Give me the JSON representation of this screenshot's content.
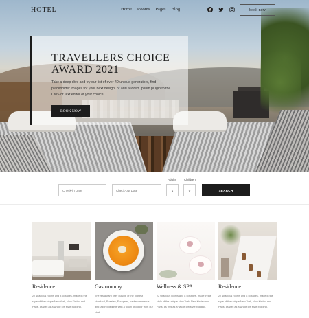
{
  "nav": {
    "logo": "HOTEL",
    "menu": [
      "Home",
      "Rooms",
      "Pages",
      "Blog"
    ],
    "social": [
      "facebook-icon",
      "twitter-icon",
      "instagram-icon"
    ],
    "book_label": "book now"
  },
  "hero": {
    "title": "TRAVELLERS CHOICE AWARD 2021",
    "text": "Take a deep dive and try our list of over 40 unique generators, find placeholder images for your next design, or add a lorem ipsum plugin to the CMS or text editor of your choice.",
    "button": "BOOK NOW"
  },
  "booking": {
    "checkin_placeholder": "Check-in Date",
    "checkout_placeholder": "Check-out Date",
    "adults_label": "Adults",
    "children_label": "Children",
    "adults_value": "1",
    "children_value": "0",
    "search_label": "SEARCH"
  },
  "cards": [
    {
      "title": "Residence",
      "desc": "22 spacious rooms and 8 cottages, made in the style of the unique New York, New Kirdan and Paris, as well as a whole loft style building."
    },
    {
      "title": "Gastronomy",
      "desc": "The restaurant offer cuisine of the highest standard, Russian, European, barbecue menus and tasting delights with a touch of colour from our chef."
    },
    {
      "title": "Wellness & SPA",
      "desc": "22 spacious rooms and 8 cottages, made in the style of the unique New York, New Kirdan and Paris, as well as a whole loft style building."
    },
    {
      "title": "Residence",
      "desc": "22 spacious rooms and 8 cottages, made in the style of the unique New York, New Kirdan and Paris, as well as a whole loft style building."
    }
  ]
}
